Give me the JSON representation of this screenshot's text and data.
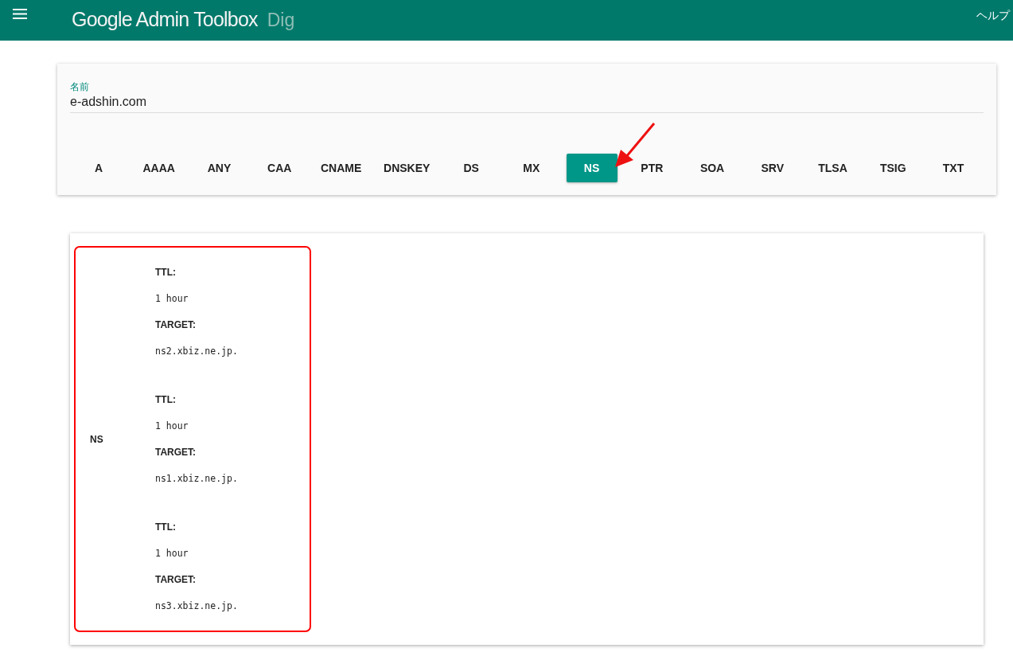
{
  "header": {
    "title": "Google Admin Toolbox",
    "subtitle": "Dig",
    "help": "ヘルプ"
  },
  "query": {
    "label": "名前",
    "value": "e-adshin.com"
  },
  "record_types": [
    {
      "label": "A",
      "selected": false
    },
    {
      "label": "AAAA",
      "selected": false
    },
    {
      "label": "ANY",
      "selected": false
    },
    {
      "label": "CAA",
      "selected": false
    },
    {
      "label": "CNAME",
      "selected": false
    },
    {
      "label": "DNSKEY",
      "selected": false
    },
    {
      "label": "DS",
      "selected": false
    },
    {
      "label": "MX",
      "selected": false
    },
    {
      "label": "NS",
      "selected": true
    },
    {
      "label": "PTR",
      "selected": false
    },
    {
      "label": "SOA",
      "selected": false
    },
    {
      "label": "SRV",
      "selected": false
    },
    {
      "label": "TLSA",
      "selected": false
    },
    {
      "label": "TSIG",
      "selected": false
    },
    {
      "label": "TXT",
      "selected": false
    }
  ],
  "result": {
    "type": "NS",
    "records": [
      {
        "ttl_label": "TTL:",
        "ttl": "1 hour",
        "target_label": "TARGET:",
        "target": "ns2.xbiz.ne.jp."
      },
      {
        "ttl_label": "TTL:",
        "ttl": "1 hour",
        "target_label": "TARGET:",
        "target": "ns1.xbiz.ne.jp."
      },
      {
        "ttl_label": "TTL:",
        "ttl": "1 hour",
        "target_label": "TARGET:",
        "target": "ns3.xbiz.ne.jp."
      }
    ]
  }
}
